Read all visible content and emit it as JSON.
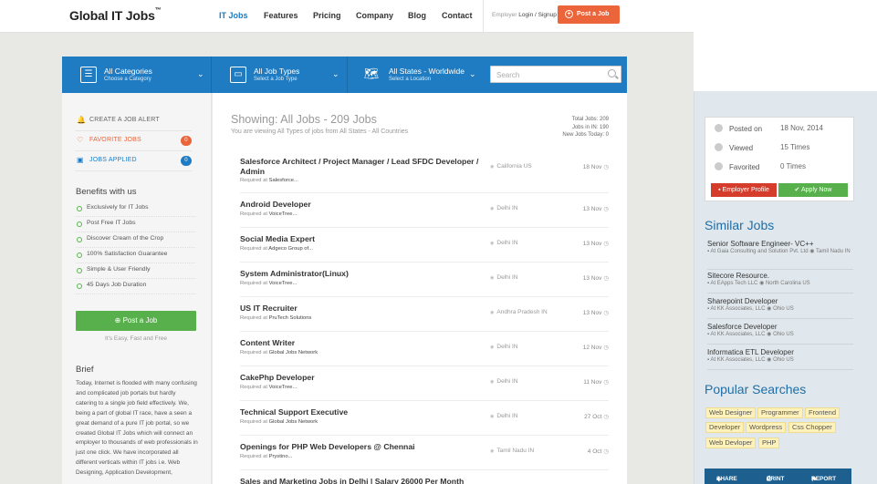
{
  "header": {
    "logo": "Global IT Jobs",
    "logo_tm": "™",
    "nav": [
      "IT Jobs",
      "Features",
      "Pricing",
      "Company",
      "Blog",
      "Contact"
    ],
    "employer_label": "Employer",
    "login_signup": "Login / Signup",
    "post_job": "Post a Job"
  },
  "filters": [
    {
      "title": "All Categories",
      "sub": "Choose a Category"
    },
    {
      "title": "All Job Types",
      "sub": "Select a Job Type"
    },
    {
      "title": "All States - Worldwide",
      "sub": "Select a Location"
    }
  ],
  "search": {
    "placeholder": "Search"
  },
  "sidebar": {
    "links": [
      {
        "label": "CREATE A JOB ALERT"
      },
      {
        "label": "FAVORITE JOBS",
        "count": "0"
      },
      {
        "label": "JOBS APPLIED",
        "count": "0"
      }
    ],
    "benefits_title": "Benefits with us",
    "benefits": [
      "Exclusively for IT Jobs",
      "Post Free IT Jobs",
      "Discover Cream of the Crop",
      "100% Satisfaction Guarantee",
      "Simple & User Friendly",
      "45 Days Job Duration"
    ],
    "post_button": "Post a Job",
    "post_sub": "It's Easy, Fast and Free",
    "brief_title": "Brief",
    "brief_text": "Today, Internet is flooded with many confusing and complicated job portals but hardly catering to a single job field effectively. We, being a part of global IT race, have a seen a great demand of a pure IT job portal, so we created Global IT Jobs which will connect an employer to thousands of web professionals in just one click. We have incorporated all different verticals within IT jobs i.e. Web Designing, Application Development,"
  },
  "listing": {
    "showing_prefix": "Showing:",
    "showing_main": "All Jobs - 209 Jobs",
    "subtitle": "You are viewing All Types of jobs from All States - All Countries",
    "stats": [
      "Total Jobs: 209",
      "Jobs in IN: 190",
      "New Jobs Today: 0"
    ],
    "required_prefix": "Required at",
    "jobs": [
      {
        "title": "Salesforce Architect / Project Manager / Lead SFDC Developer / Admin",
        "company": "Salesforce...",
        "location": "California US",
        "date": "18 Nov"
      },
      {
        "title": "Android Developer",
        "company": "VoiceTree...",
        "location": "Delhi IN",
        "date": "13 Nov"
      },
      {
        "title": "Social Media Expert",
        "company": "Adgeco Group of...",
        "location": "Delhi IN",
        "date": "13 Nov"
      },
      {
        "title": "System Administrator(Linux)",
        "company": "VoiceTree...",
        "location": "Delhi IN",
        "date": "13 Nov"
      },
      {
        "title": "US IT Recruiter",
        "company": "PruTech Solutions",
        "location": "Andhra Pradesh IN",
        "date": "13 Nov"
      },
      {
        "title": "Content Writer",
        "company": "Global Jobs Network",
        "location": "Delhi IN",
        "date": "12 Nov"
      },
      {
        "title": "CakePhp Developer",
        "company": "VoiceTree...",
        "location": "Delhi IN",
        "date": "11 Nov"
      },
      {
        "title": "Technical Support Executive",
        "company": "Global Jobs Network",
        "location": "Delhi IN",
        "date": "27 Oct"
      },
      {
        "title": "Openings for PHP Web Developers @ Chennai",
        "company": "Prystino...",
        "location": "Tamil Nadu IN",
        "date": "4 Oct"
      },
      {
        "title": "Sales and Marketing Jobs in Delhi | Salary 26000 Per Month",
        "company": "",
        "location": "",
        "date": ""
      }
    ]
  },
  "job_info": {
    "rows": [
      {
        "label": "Posted on",
        "value": "18 Nov, 2014"
      },
      {
        "label": "Viewed",
        "value": "15 Times"
      },
      {
        "label": "Favorited",
        "value": "0 Times"
      }
    ],
    "employer_btn": "Employer Profile",
    "apply_btn": "Apply Now"
  },
  "similar": {
    "title": "Similar Jobs",
    "items": [
      {
        "title": "Senior Software Engineer- VC++",
        "company": "At Gaia Consulting and Solution Pvt. Ltd",
        "location": "Tamil Nadu IN"
      },
      {
        "title": "Sitecore Resource.",
        "company": "At EApps Tech LLC",
        "location": "North Carolina US"
      },
      {
        "title": "Sharepoint Developer",
        "company": "At KK Associates, LLC",
        "location": "Ohio US"
      },
      {
        "title": "Salesforce Developer",
        "company": "At KK Associates, LLC",
        "location": "Ohio US"
      },
      {
        "title": "Informatica ETL Developer",
        "company": "At KK Associates, LLC",
        "location": "Ohio US"
      }
    ]
  },
  "popular": {
    "title": "Popular Searches",
    "tags": [
      "Web Designer",
      "Programmer",
      "Frontend",
      "Developer",
      "Wordpress",
      "Css Chopper",
      "Web Devloper",
      "PHP"
    ]
  },
  "share_bar": [
    "SHARE",
    "PRINT",
    "REPORT"
  ],
  "colors": {
    "brand_blue": "#1f7cc4",
    "orange": "#ec6439",
    "green": "#57b04b",
    "red": "#d63c2b"
  }
}
